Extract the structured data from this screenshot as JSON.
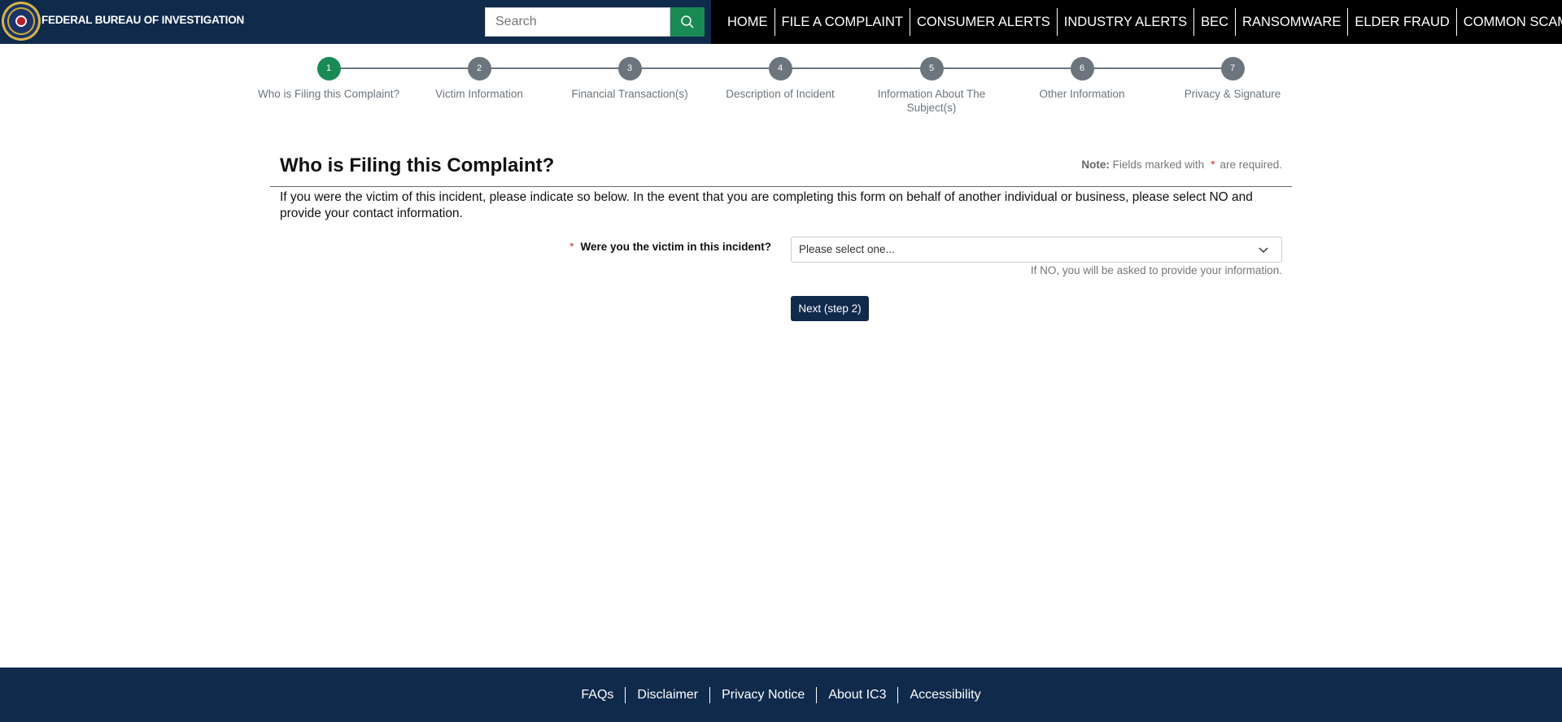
{
  "header": {
    "brand": "FEDERAL BUREAU OF INVESTIGATION",
    "search_placeholder": "Search"
  },
  "nav": [
    "HOME",
    "FILE A COMPLAINT",
    "CONSUMER ALERTS",
    "INDUSTRY ALERTS",
    "BEC",
    "RANSOMWARE",
    "ELDER FRAUD",
    "COMMON SCAMS"
  ],
  "steps": [
    {
      "num": "1",
      "label": "Who is Filing this Complaint?"
    },
    {
      "num": "2",
      "label": "Victim Information"
    },
    {
      "num": "3",
      "label": "Financial Transaction(s)"
    },
    {
      "num": "4",
      "label": "Description of Incident"
    },
    {
      "num": "5",
      "label": "Information About The Subject(s)"
    },
    {
      "num": "6",
      "label": "Other Information"
    },
    {
      "num": "7",
      "label": "Privacy & Signature"
    }
  ],
  "active_step": 1,
  "form": {
    "title": "Who is Filing this Complaint?",
    "note_label": "Note:",
    "note_text": "Fields marked with",
    "required_mark": "*",
    "note_suffix": "are required.",
    "intro": "If you were the victim of this incident, please indicate so below. In the event that you are completing this form on behalf of another individual or business, please select NO and provide your contact information.",
    "question": "Were you the victim in this incident?",
    "select_value": "Please select one...",
    "hint": "If NO, you will be asked to provide your information.",
    "next_label": "Next (step 2)"
  },
  "footer": [
    "FAQs",
    "Disclaimer",
    "Privacy Notice",
    "About IC3",
    "Accessibility"
  ],
  "colors": {
    "navy": "#102a4c",
    "green": "#1a8a55",
    "step_gray": "#6c757d",
    "required": "#d0312d"
  }
}
